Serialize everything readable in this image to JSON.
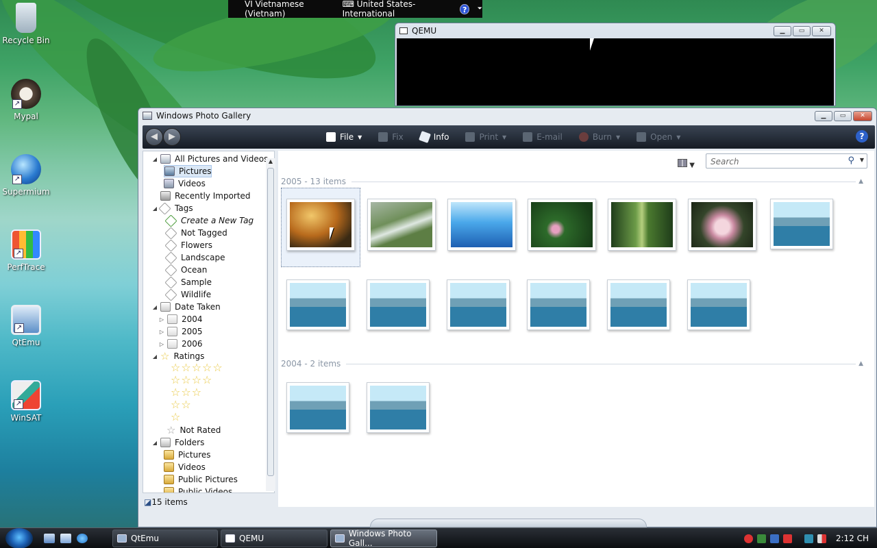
{
  "desktop": {
    "icons": [
      "Recycle Bin",
      "Mypal",
      "Supermium",
      "PerfTrace",
      "QtEmu",
      "WinSAT"
    ]
  },
  "langbar": {
    "language": "VI Vietnamese (Vietnam)",
    "keyboard": "United States-International",
    "help": "?"
  },
  "qemu_window": {
    "title": "QEMU"
  },
  "gallery": {
    "title": "Windows Photo Gallery",
    "toolbar": {
      "file": "File",
      "fix": "Fix",
      "info": "Info",
      "print": "Print",
      "email": "E-mail",
      "burn": "Burn",
      "open": "Open",
      "help": "?"
    },
    "nav": {
      "all": "All Pictures and Videos",
      "pictures": "Pictures",
      "videos": "Videos",
      "recently_imported": "Recently Imported",
      "tags": "Tags",
      "create_tag": "Create a New Tag",
      "not_tagged": "Not Tagged",
      "flowers": "Flowers",
      "landscape": "Landscape",
      "ocean": "Ocean",
      "sample": "Sample",
      "wildlife": "Wildlife",
      "date_taken": "Date Taken",
      "y2004": "2004",
      "y2005": "2005",
      "y2006": "2006",
      "ratings": "Ratings",
      "not_rated": "Not Rated",
      "folders": "Folders",
      "f_pictures": "Pictures",
      "f_videos": "Videos",
      "public_pictures": "Public Pictures",
      "public_videos": "Public Videos"
    },
    "search_placeholder": "Search",
    "groups": [
      {
        "label": "2005 - 13 items"
      },
      {
        "label": "2004 - 2 items"
      }
    ],
    "status": "15 items"
  },
  "taskbar": {
    "tasks": [
      "QtEmu",
      "QEMU",
      "Windows Photo Gall..."
    ],
    "clock": "2:12 CH"
  },
  "colors": {
    "accent": "#2d61c9",
    "toolbar": "#1f2731",
    "selection": "#dbe8f6"
  }
}
